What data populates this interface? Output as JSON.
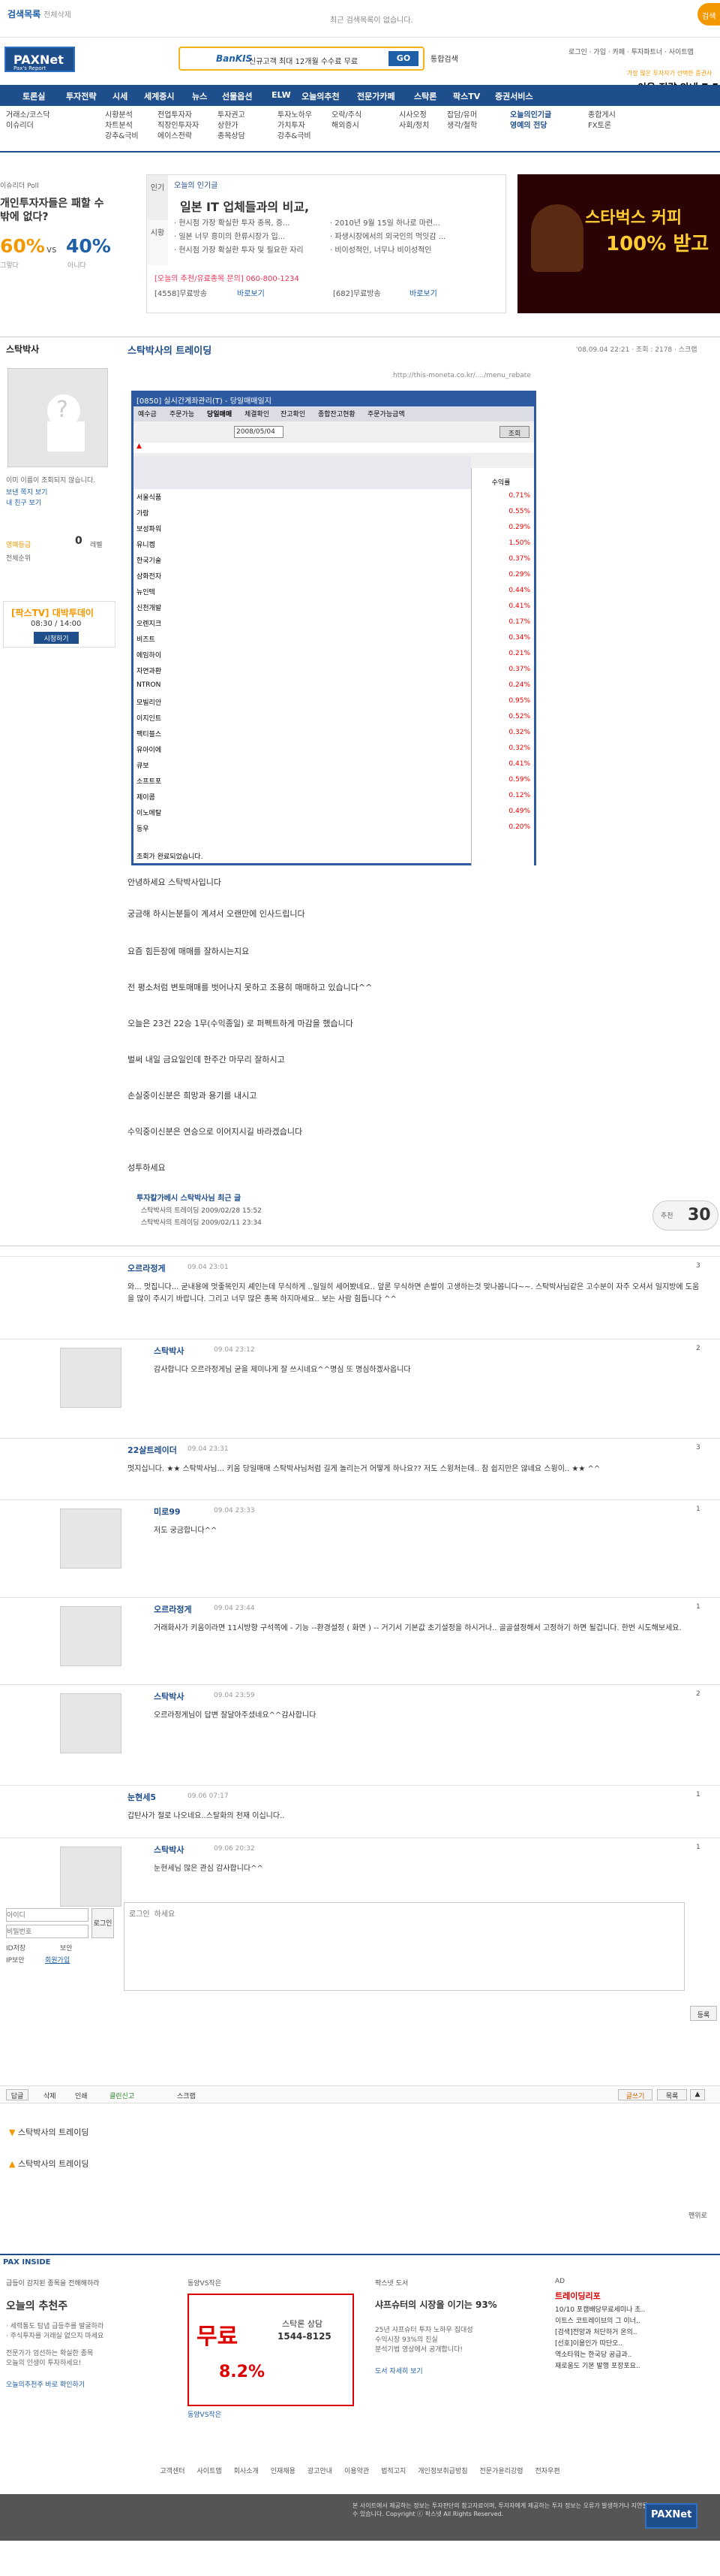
{
  "topbar": {
    "search_history": "검색목록",
    "search_history_sub": "전체삭제",
    "center_msg": "최근 검색목록이 없습니다."
  },
  "header": {
    "logo": "PAXNet",
    "logo_sub": "Pax's Report",
    "banner_brand": "BanKIS",
    "banner_text": "신규고객 최대 12개월 수수료 무료",
    "go": "GO",
    "unified": "통합검색",
    "toplinks": "로그인 · 가입 · 카페 · 투자파트너 · 사이트맵",
    "ad_top": "가장 많은 투자자가 선택한 증권사",
    "ad_main": "이용 전략 안내 7.5"
  },
  "nav": [
    "토론실",
    "투자전략",
    "시세",
    "세계증시",
    "뉴스",
    "선물옵션",
    "ELW",
    "오늘의추천",
    "전문가카페",
    "스탁론",
    "팍스TV",
    "증권서비스"
  ],
  "subnav": [
    "거래소/코스닥\n이슈리더\n",
    "시황분석\n차트분석\n강추&극비",
    "전업투자자\n직장인투자자\n에이스전략",
    "투자권고\n상한가\n종목상담",
    "투자노하우\n가치투자\n강추&극비",
    "오락/주식\n해외증시\n",
    "시사오정\n사회/정치",
    "잡담/유머\n생각/철학",
    "오늘의인기글\n영예의 전당",
    "종합게시\nFX토론"
  ],
  "poll": {
    "head": "이슈리더 Poll",
    "question": "개인투자자들은 패할 수 밖에 없다?",
    "yes_pct": "60%",
    "vs": "vs",
    "no_pct": "40%",
    "yes_label": "그렇다",
    "no_label": "아니다"
  },
  "hot": {
    "tab1": "인기",
    "tab2": "시황",
    "header": "오늘의 인기글",
    "title": "일본 IT 업체들과의 비교,",
    "lines": [
      "· 현시점 가장 확실한 투자 종목, 증...",
      "· 일본 너무 흥미의 한류시장가 입...",
      "· 현시점 가장 확실한 투자 및 필요한 자리",
      "· 2010년 9월 15일 하나로 마련...",
      "· 파생시장에서의 외국인의 먹잇감 ...",
      "· 비이성적인, 너무나 비이성적인"
    ],
    "phone_line": "[오늘의 추천/유료종목 문의] 060-800-1234",
    "line_a": "[4558]무료방송",
    "line_b": "[682]무료방송",
    "link_a": "바로보기",
    "link_b": "바로보기"
  },
  "ad_coffee": {
    "line1": "스타벅스 커피",
    "line2": "100% 받고"
  },
  "profile": {
    "name": "스탁박사",
    "sub1": "이미 이름이 조회되지 않습니다.",
    "sub2": "보낸 쪽지 보기",
    "sub3": "내 친구 보기",
    "grade_label": "영예등급",
    "grade": "0",
    "grade_unit": "레벨",
    "rank": "전체순위",
    "event_title": "[팍스TV] 대박투데이",
    "event_time": "08:30 / 14:00",
    "event_btn": "시청하기"
  },
  "post": {
    "title": "스탁박사의 트레이딩",
    "meta": "'08.09.04 22:21 · 조회 : 2178 · 스크랩",
    "url": "http://this-moneta.co.kr/..../menu_rebate"
  },
  "hts": {
    "title": "[0850] 실시간계좌관리(T) - 당일매매일지",
    "tabs": [
      "예수금",
      "주문가능",
      "당일매매",
      "체결확인",
      "잔고확인",
      "종합잔고현황",
      "주문가능금액"
    ],
    "date": "2008/05/04",
    "search": "조회",
    "rows": [
      {
        "name": "서울식품",
        "ret": "0.71%"
      },
      {
        "name": "가람",
        "ret": "0.55%"
      },
      {
        "name": "보성파워",
        "ret": "0.29%"
      },
      {
        "name": "유니켐",
        "ret": "1.50%"
      },
      {
        "name": "한국기술",
        "ret": "0.37%"
      },
      {
        "name": "삼화전자",
        "ret": "0.29%"
      },
      {
        "name": "뉴인텍",
        "ret": "0.44%"
      },
      {
        "name": "신천개발",
        "ret": "0.41%"
      },
      {
        "name": "오렌지크",
        "ret": "0.17%"
      },
      {
        "name": "비즈트",
        "ret": "0.34%"
      },
      {
        "name": "에임하이",
        "ret": "0.21%"
      },
      {
        "name": "자연과환",
        "ret": "0.37%"
      },
      {
        "name": "NTRON",
        "ret": "0.24%"
      },
      {
        "name": "모빌리안",
        "ret": "0.95%"
      },
      {
        "name": "이지인트",
        "ret": "0.52%"
      },
      {
        "name": "팩티블스",
        "ret": "0.32%"
      },
      {
        "name": "유아이에",
        "ret": "0.32%"
      },
      {
        "name": "큐보",
        "ret": "0.41%"
      },
      {
        "name": "소프트포",
        "ret": "0.59%"
      },
      {
        "name": "제이콤",
        "ret": "0.12%"
      },
      {
        "name": "이노메탈",
        "ret": "0.49%"
      },
      {
        "name": "동우",
        "ret": "0.20%"
      }
    ],
    "ret_header": "수익률",
    "footer": "조회가 완료되었습니다."
  },
  "body": [
    "안녕하세요 스탁박사입니다",
    "궁금해 하시는분들이 계셔서 오랜만에 인사드립니다",
    "요즘 힘든장에 매매를 잘하시는지요",
    "전 평소처럼 변토매매를 벗어나지 못하고 조용히 매매하고 있습니다^^",
    "오늘은 23건 22승 1무(수익종일) 로 퍼펙트하게 마감을 했습니다",
    "벌써 내일 금요일인데 한주간 마무리 잘하시고",
    "손실중이신분은 희망과 용기를 내시고",
    "수익중이신분은 연승으로 이어지시길 바라겠습니다",
    "성투하세요"
  ],
  "related": {
    "title": "투자칼가베시 스탁박사님 최근 글",
    "items": [
      "스탁박사의 트레이딩  2009/02/28 15:52",
      "스탁박사의 트레이딩  2009/02/11 23:34"
    ],
    "recommend_label": "추천",
    "recommend": "30"
  },
  "comments": [
    {
      "name": "오르라정게",
      "date": "09.04 23:01",
      "num": "3",
      "text": "와... 멋집니다... 굳내용에 멋좋목인지 셰인는데 무식하게 ..일일히 세어봤네요.. 앞론 무식하면 손발이 고생하는것 맞나봅니다~~. 스탁박사님같은 고수분이 자주 오셔서 일지방에 도움을 많이 주시기 바랍니다. 그리고 너무 많은 종목 하지마세요.. 보는 사람 힘듭니다 ^^"
    },
    {
      "name": "스탁박사",
      "date": "09.04 23:12",
      "num": "2",
      "text": "감사합니다 오르라정게님 굳을 제미나게 잘 쓰시네요^^명심 또 명심하겠사옵니다"
    },
    {
      "name": "22살트레이더",
      "date": "09.04 23:31",
      "num": "3",
      "text": "멋지십니다. ★★ 스탁박사님... 키움 당일매매 스탁박사님처럼 길게 놀리는거 어떻게 하나요?? 저도 스윙처는데.. 참 쉽지만은 않네요 스윙이.. ★★ ^^"
    },
    {
      "name": "미로99",
      "date": "09.04 23:33",
      "num": "1",
      "text": "저도 궁금합니다^^"
    },
    {
      "name": "오르라정게",
      "date": "09.04 23:44",
      "num": "1",
      "text": "거래화사가 키움이라면 11시방향 구석쪽에 - 기능 --환경설정 ( 화면 ) -- 거기서 기본값 초기설정을 하시거나.. 골골설정해서 고정하기 하면 될겁니다. 한번 시도해보세요."
    },
    {
      "name": "스탁박사",
      "date": "09.04 23:59",
      "num": "2",
      "text": "오르라정게님이 답변 잘달아주셨네요^^감사합니다"
    },
    {
      "name": "눈현세5",
      "date": "09.06 07:17",
      "num": "1",
      "text": "갑탄사가 절로 나오네요..스탈화의 천재 이십니다.."
    },
    {
      "name": "스탁박사",
      "date": "09.06 20:32",
      "num": "1",
      "text": "눈현세님 많은 관심 감사합니다^^"
    }
  ],
  "login": {
    "id_placeholder": "아이디",
    "pw_placeholder": "비밀번호",
    "btn": "로그인",
    "save_id": "ID저장",
    "secure": "보안",
    "ip_label": "IP보안",
    "join": "회원가입"
  },
  "reply": {
    "placeholder": "로그인 하세요",
    "submit": "등록"
  },
  "actions": {
    "reply_btn": "답글",
    "delete_btn": "삭제",
    "print_btn": "인쇄",
    "clean_report": "클린신고",
    "scrap": "스크랩",
    "write": "글쓰기",
    "list": "목록"
  },
  "links": [
    "스탁박사의 트레이딩",
    "스탁박사의 트레이딩"
  ],
  "page_more": "맨위로",
  "inside": {
    "title": "PAX INSIDE",
    "col1": {
      "head": "급등이 감지된 종목을 전해해하라",
      "title": "오늘의 추천주",
      "lines": [
        "· 세력통도 탐냅 급등주를 발굴하라",
        "· 주식투자를 거래실 없으지 마세요",
        "전문가가 엄선하는 확실한 종목",
        "오늘의 인생이 투자하세요!"
      ],
      "link": "오늘의추천주 바로 확인하기"
    },
    "col2": {
      "head": "동양VS작은",
      "title": "스탁론 상담",
      "phone": "1544-8125",
      "rate": "8.2%",
      "free": "무료",
      "link": "동양VS작은"
    },
    "col3": {
      "head": "팍스넷 도서",
      "title": "샤프슈터의 시장을 이기는 93%",
      "lines": [
        "25년 샤프슈터 투자 노하우 집대성",
        "수익시장 93%의 진실",
        "분석기법 영상에서 공개합니다!"
      ],
      "link": "도서 자세히 보기"
    },
    "col4": {
      "head": "AD",
      "title": "트레이딩리포",
      "lines": [
        "10/10 포캠배당무료세미나 초..",
        "이트스 코트레이브의 그 이너..",
        "[검색]전망과 처단하거 온의..",
        "[선호]이용인가 따단오..",
        "역소타워는 한국당 공급과..",
        "재로움도 기본 발행 포장포요.."
      ]
    }
  },
  "footer_links": [
    "고객센터",
    "사이트맵",
    "회사소개",
    "인재채용",
    "광고안내",
    "이용약관",
    "법적고지",
    "개인정보취급방침",
    "전문가윤리강령",
    "전자우편"
  ],
  "footer": {
    "copy": "본 사이트에서 제공하는 정보는 투자판단의 참고자료이며, 투자자에게 제공하는 투자 정보는 오류가 발생하거나 지연될 수 있습니다. Copyright ⓒ 팍스넷 All Rights Reserved.",
    "logo": "PAXNet"
  }
}
